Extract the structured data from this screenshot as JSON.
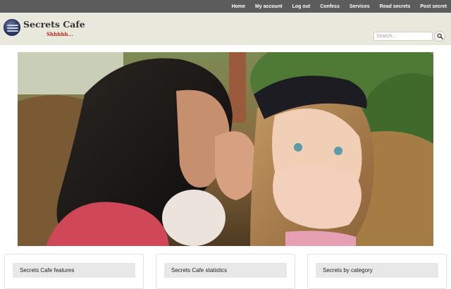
{
  "nav": {
    "items": [
      "Home",
      "My account",
      "Log out",
      "Confess",
      "Services",
      "Read secrets",
      "Post secret"
    ]
  },
  "brand": {
    "title": "Secrets Cafe",
    "tagline": "Shhhhh..."
  },
  "search": {
    "placeholder": "Search..."
  },
  "cards": [
    {
      "title": "Secrets Cafe features"
    },
    {
      "title": "Secrets Cafe statistics"
    },
    {
      "title": "Secrets by category"
    }
  ],
  "icons": {
    "search_button": "search-icon",
    "logo": "logo-mark-icon"
  },
  "colors": {
    "topbar": "#5c5c5c",
    "header": "#e9e8dc",
    "tagline": "#c3261b"
  }
}
